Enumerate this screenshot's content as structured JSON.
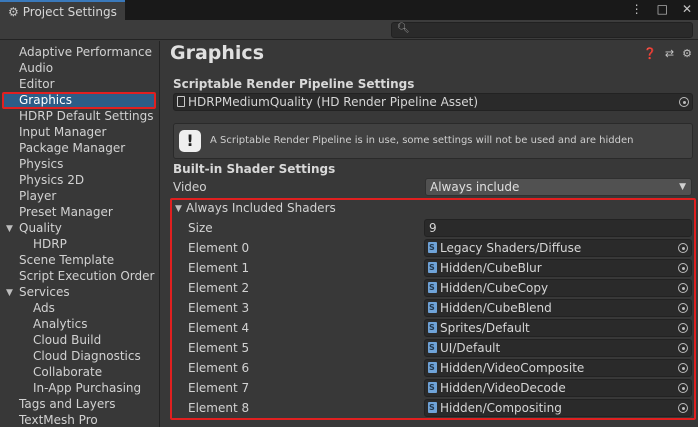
{
  "window": {
    "tab_title": "Project Settings",
    "menu_glyph": "⋮",
    "maximize_glyph": "□",
    "close_glyph": "✕"
  },
  "search": {
    "placeholder": ""
  },
  "sidebar": {
    "items": [
      {
        "label": "Adaptive Performance"
      },
      {
        "label": "Audio"
      },
      {
        "label": "Editor"
      },
      {
        "label": "Graphics",
        "selected": true
      },
      {
        "label": "HDRP Default Settings"
      },
      {
        "label": "Input Manager"
      },
      {
        "label": "Package Manager"
      },
      {
        "label": "Physics"
      },
      {
        "label": "Physics 2D"
      },
      {
        "label": "Player"
      },
      {
        "label": "Preset Manager"
      },
      {
        "label": "Quality",
        "expanded": true
      },
      {
        "label": "HDRP",
        "child": true
      },
      {
        "label": "Scene Template"
      },
      {
        "label": "Script Execution Order"
      },
      {
        "label": "Services",
        "expanded": true
      },
      {
        "label": "Ads",
        "child": true
      },
      {
        "label": "Analytics",
        "child": true
      },
      {
        "label": "Cloud Build",
        "child": true
      },
      {
        "label": "Cloud Diagnostics",
        "child": true
      },
      {
        "label": "Collaborate",
        "child": true
      },
      {
        "label": "In-App Purchasing",
        "child": true
      },
      {
        "label": "Tags and Layers"
      },
      {
        "label": "TextMesh Pro"
      }
    ]
  },
  "main": {
    "title": "Graphics",
    "srp_section": "Scriptable Render Pipeline Settings",
    "srp_asset": "HDRPMediumQuality (HD Render Pipeline Asset)",
    "help_message": "A Scriptable Render Pipeline is in use, some settings will not be used and are hidden",
    "builtin_section": "Built-in Shader Settings",
    "video_label": "Video",
    "video_value": "Always include",
    "always_included": {
      "label": "Always Included Shaders",
      "size_label": "Size",
      "size_value": "9",
      "elements": [
        {
          "label": "Element 0",
          "value": "Legacy Shaders/Diffuse"
        },
        {
          "label": "Element 1",
          "value": "Hidden/CubeBlur"
        },
        {
          "label": "Element 2",
          "value": "Hidden/CubeCopy"
        },
        {
          "label": "Element 3",
          "value": "Hidden/CubeBlend"
        },
        {
          "label": "Element 4",
          "value": "Sprites/Default"
        },
        {
          "label": "Element 5",
          "value": "UI/Default"
        },
        {
          "label": "Element 6",
          "value": "Hidden/VideoComposite"
        },
        {
          "label": "Element 7",
          "value": "Hidden/VideoDecode"
        },
        {
          "label": "Element 8",
          "value": "Hidden/Compositing"
        }
      ]
    }
  },
  "colors": {
    "highlight_red": "#e02020",
    "selection_blue": "#2c5d87",
    "tab_accent": "#3a79bb"
  }
}
